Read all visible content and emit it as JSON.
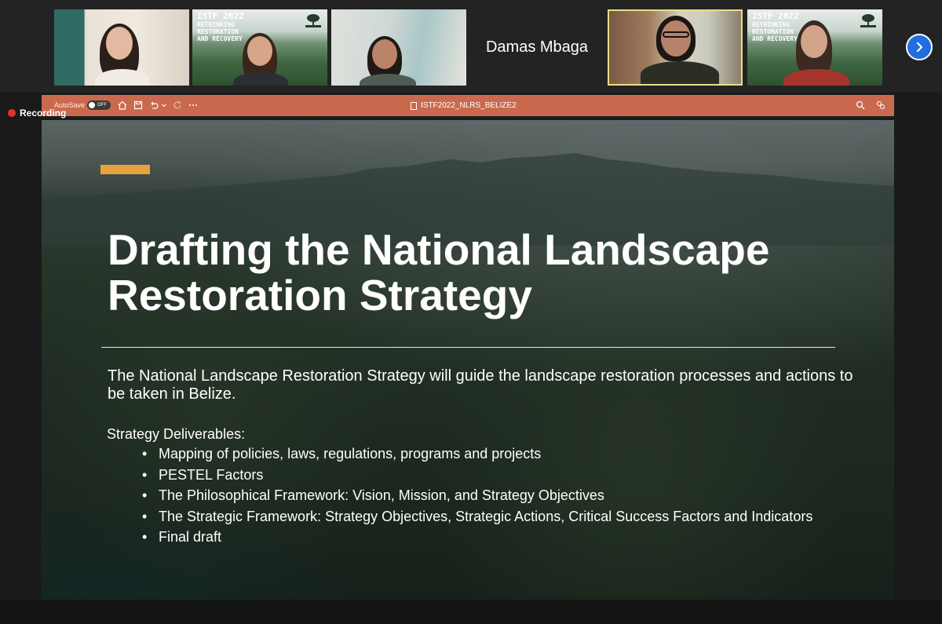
{
  "participants": [
    {
      "kind": "camera",
      "bg": "#d8d2c7"
    },
    {
      "kind": "branded",
      "bg": "#3f6a4a",
      "brand_title": "ISTF 2022",
      "brand_lines": [
        "RETHINKING",
        "RESTORATION",
        "AND RECOVERY"
      ]
    },
    {
      "kind": "camera",
      "bg": "#c9d3d2"
    },
    {
      "kind": "name",
      "name": "Damas Mbaga"
    },
    {
      "kind": "camera",
      "bg": "#8a6a50",
      "active": true
    },
    {
      "kind": "branded",
      "bg": "#3f6a4a",
      "brand_title": "ISTF 2022",
      "brand_lines": [
        "RETHINKING",
        "RESTORATION",
        "AND RECOVERY"
      ]
    }
  ],
  "recording": {
    "label": "Recording",
    "color": "#e0322e"
  },
  "ppt_toolbar": {
    "autosave_label": "AutoSave",
    "toggle_label": "OFF",
    "document_title": "ISTF2022_NLRS_BELIZE2",
    "color": "#c96a4f"
  },
  "slide": {
    "title": "Drafting the National Landscape Restoration Strategy",
    "intro": "The National Landscape Restoration Strategy will guide the landscape restoration processes and actions to be taken in Belize.",
    "deliverables_heading": "Strategy Deliverables:",
    "deliverables": [
      "Mapping of policies, laws, regulations, programs and projects",
      "PESTEL Factors",
      "The Philosophical Framework: Vision, Mission, and Strategy Objectives",
      "The Strategic Framework: Strategy Objectives, Strategic Actions, Critical Success Factors and Indicators",
      "Final draft"
    ],
    "accent_color": "#e8a23a"
  },
  "icons": [
    "chevron-right-icon",
    "home-icon",
    "save-icon",
    "undo-icon",
    "redo-icon",
    "more-icon",
    "file-icon",
    "search-icon",
    "share-icon"
  ]
}
